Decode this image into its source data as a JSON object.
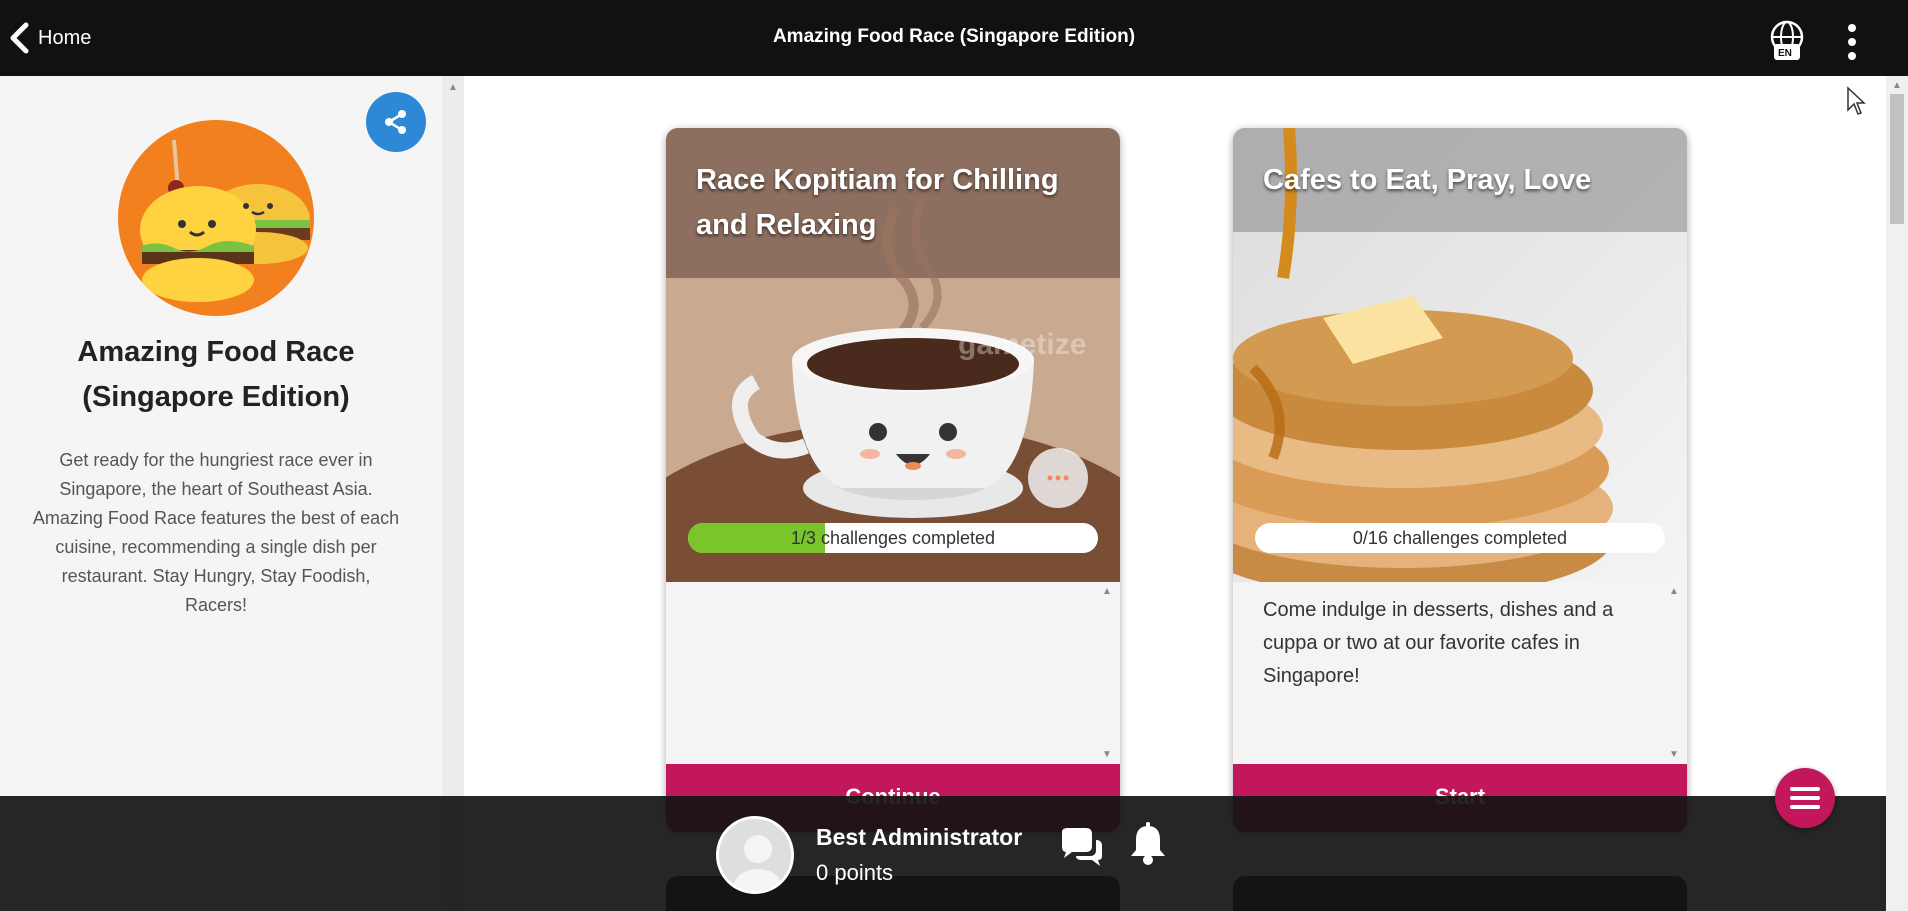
{
  "topbar": {
    "home_label": "Home",
    "title": "Amazing Food Race (Singapore Edition)",
    "language_code": "EN"
  },
  "sidebar": {
    "game_title": "Amazing Food Race (Singapore Edition)",
    "description": "Get ready for the hungriest race ever in Singapore, the heart of Southeast Asia. Amazing Food Race features the best of each cuisine, recommending a single dish per restaurant. Stay Hungry, Stay Foodish, Racers!",
    "share_icon": "share-icon"
  },
  "cards": [
    {
      "title": "Race Kopitiam for Chilling and Relaxing",
      "progress_text": "1/3 challenges completed",
      "progress_fraction": 0.333,
      "description": "",
      "button_label": "Continue",
      "watermark": "gametize"
    },
    {
      "title": "Cafes to Eat, Pray, Love",
      "progress_text": "0/16 challenges completed",
      "progress_fraction": 0,
      "description": "Come indulge in desserts, dishes and a cuppa or two at our favorite cafes in Singapore!",
      "button_label": "Start"
    }
  ],
  "user": {
    "name": "Best Administrator",
    "points": "0 points"
  },
  "colors": {
    "topbar": "#111111",
    "accent": "#c2185b",
    "share": "#2d89d6",
    "progress": "#7ac52b",
    "logo_bg": "#f2801f"
  }
}
